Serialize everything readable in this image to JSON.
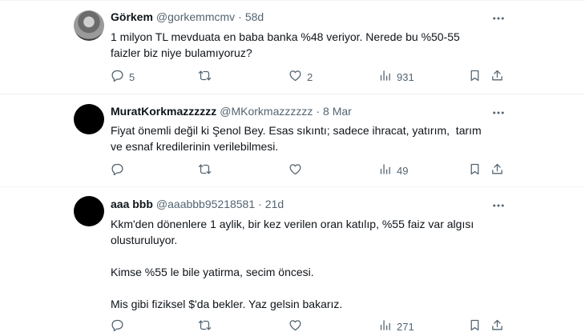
{
  "tweets": [
    {
      "name": "Görkem",
      "handle": "@gorkemmcmv",
      "time": "58d",
      "text": "1 milyon TL mevduata en baba banka %48 veriyor. Nerede bu %50-55\nfaizler biz niye bulamıyoruz?",
      "replies": "5",
      "retweets": "",
      "likes": "2",
      "views": "931"
    },
    {
      "name": "MuratKorkmazzzzzz",
      "handle": "@MKorkmazzzzzz",
      "time": "8 Mar",
      "text": "Fiyat önemli değil ki Şenol Bey. Esas sıkıntı; sadece ihracat, yatırım,  tarım\nve esnaf kredilerinin verilebilmesi.",
      "replies": "",
      "retweets": "",
      "likes": "",
      "views": "49"
    },
    {
      "name": "aaa bbb",
      "handle": "@aaabbb95218581",
      "time": "21d",
      "text": "Kkm'den dönenlere 1 aylik, bir kez verilen oran katılıp, %55 faiz var algısı\nolusturuluyor.\n\nKimse %55 le bile yatirma, secim öncesi.\n\nMis gibi fiziksel $'da bekler. Yaz gelsin bakarız.",
      "replies": "",
      "retweets": "",
      "likes": "",
      "views": "271"
    }
  ],
  "icons": {
    "reply": "reply-icon",
    "retweet": "retweet-icon",
    "like": "like-icon",
    "views": "views-icon",
    "bookmark": "bookmark-icon",
    "share": "share-icon",
    "more": "more-icon"
  }
}
